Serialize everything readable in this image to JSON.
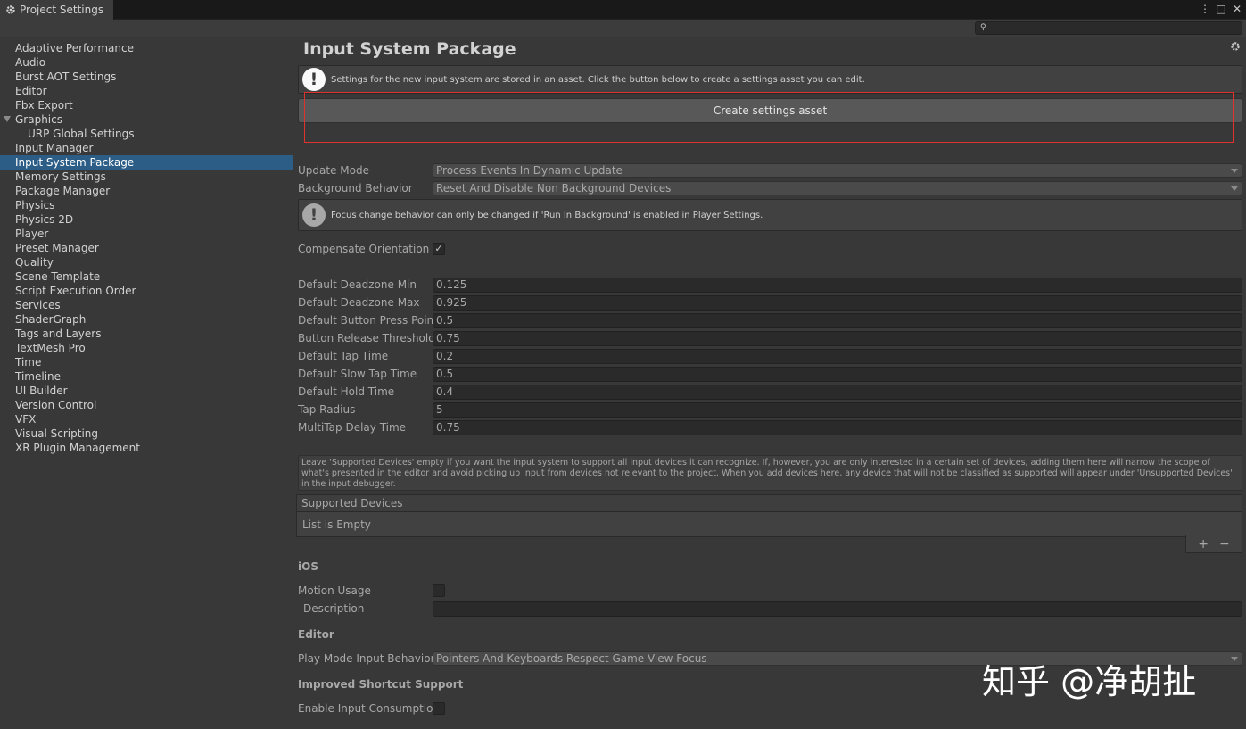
{
  "window": {
    "tab_title": "Project Settings",
    "controls": [
      "⋮",
      "□",
      "✕"
    ]
  },
  "search": {
    "placeholder": ""
  },
  "sidebar": {
    "items": [
      {
        "label": "Adaptive Performance"
      },
      {
        "label": "Audio"
      },
      {
        "label": "Burst AOT Settings"
      },
      {
        "label": "Editor"
      },
      {
        "label": "Fbx Export"
      },
      {
        "label": "Graphics",
        "expanded": true
      },
      {
        "label": "URP Global Settings",
        "child": true
      },
      {
        "label": "Input Manager"
      },
      {
        "label": "Input System Package",
        "selected": true
      },
      {
        "label": "Memory Settings"
      },
      {
        "label": "Package Manager"
      },
      {
        "label": "Physics"
      },
      {
        "label": "Physics 2D"
      },
      {
        "label": "Player"
      },
      {
        "label": "Preset Manager"
      },
      {
        "label": "Quality"
      },
      {
        "label": "Scene Template"
      },
      {
        "label": "Script Execution Order"
      },
      {
        "label": "Services"
      },
      {
        "label": "ShaderGraph"
      },
      {
        "label": "Tags and Layers"
      },
      {
        "label": "TextMesh Pro"
      },
      {
        "label": "Time"
      },
      {
        "label": "Timeline"
      },
      {
        "label": "UI Builder"
      },
      {
        "label": "Version Control"
      },
      {
        "label": "VFX"
      },
      {
        "label": "Visual Scripting"
      },
      {
        "label": "XR Plugin Management"
      }
    ]
  },
  "main": {
    "title": "Input System Package",
    "asset_help": "Settings for the new input system are stored in an asset. Click the button below to create a settings asset you can edit.",
    "create_button": "Create settings asset",
    "update_mode": {
      "label": "Update Mode",
      "value": "Process Events In Dynamic Update"
    },
    "background_behavior": {
      "label": "Background Behavior",
      "value": "Reset And Disable Non Background Devices"
    },
    "focus_help": "Focus change behavior can only be changed if 'Run In Background' is enabled in Player Settings.",
    "compensate_orientation": {
      "label": "Compensate Orientation",
      "checked": true,
      "mark": "✓"
    },
    "fields": [
      {
        "label": "Default Deadzone Min",
        "value": "0.125"
      },
      {
        "label": "Default Deadzone Max",
        "value": "0.925"
      },
      {
        "label": "Default Button Press Point",
        "value": "0.5"
      },
      {
        "label": "Button Release Threshold",
        "value": "0.75"
      },
      {
        "label": "Default Tap Time",
        "value": "0.2"
      },
      {
        "label": "Default Slow Tap Time",
        "value": "0.5"
      },
      {
        "label": "Default Hold Time",
        "value": "0.4"
      },
      {
        "label": "Tap Radius",
        "value": "5"
      },
      {
        "label": "MultiTap Delay Time",
        "value": "0.75"
      }
    ],
    "supported_devices_help": "Leave 'Supported Devices' empty if you want the input system to support all input devices it can recognize. If, however, you are only interested in a certain set of devices, adding them here will narrow the scope of what's presented in the editor and avoid picking up input from devices not relevant to the project. When you add devices here, any device that will not be classified as supported will appear under 'Unsupported Devices' in the input debugger.",
    "supported_devices": {
      "header": "Supported Devices",
      "empty_text": "List is Empty",
      "add": "+",
      "remove": "−"
    },
    "ios": {
      "section": "iOS",
      "motion_usage": {
        "label": "Motion Usage",
        "checked": false
      },
      "description": {
        "label": "Description",
        "value": ""
      }
    },
    "editor": {
      "section": "Editor",
      "play_mode": {
        "label": "Play Mode Input Behavior",
        "value": "Pointers And Keyboards Respect Game View Focus"
      }
    },
    "shortcut": {
      "section": "Improved Shortcut Support",
      "enable_input_consumption": {
        "label": "Enable Input Consumption",
        "checked": false
      }
    }
  },
  "watermark": "知乎 @净胡扯",
  "colors": {
    "background": "#383838",
    "selection": "#2c5d87",
    "highlight_rect": "#e0322d",
    "field_bg": "#2a2a2a"
  }
}
